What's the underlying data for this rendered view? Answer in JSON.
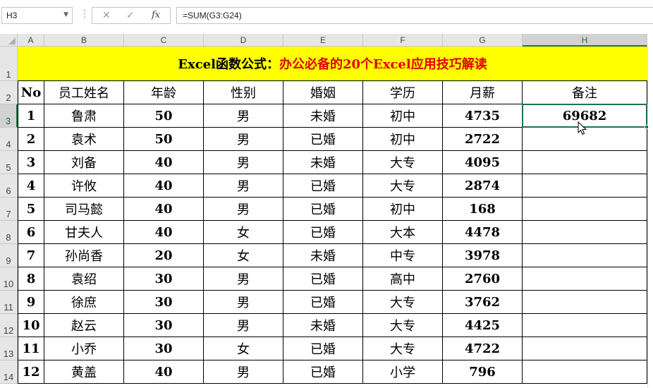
{
  "formula_bar": {
    "name_box": "H3",
    "dots": "⋮",
    "cancel_icon": "✕",
    "enter_icon": "✓",
    "fx_label": "fx",
    "formula": "=SUM(G3:G24)"
  },
  "columns": [
    "A",
    "B",
    "C",
    "D",
    "E",
    "F",
    "G",
    "H"
  ],
  "selected_column": "H",
  "rows": [
    "1",
    "2",
    "3",
    "4",
    "5",
    "6",
    "7",
    "8",
    "9",
    "10",
    "11",
    "12",
    "13",
    "14"
  ],
  "selected_row": "3",
  "title": {
    "black_part": "Excel函数公式：",
    "red_part": "办公必备的20个Excel应用技巧解读"
  },
  "colors": {
    "title_fill": "#ffff00",
    "title_red": "#e00000",
    "selection": "#217346"
  },
  "table": {
    "headers": [
      "No",
      "员工姓名",
      "年龄",
      "性别",
      "婚姻",
      "学历",
      "月薪",
      "备注"
    ],
    "rows": [
      [
        "1",
        "鲁肃",
        "50",
        "男",
        "未婚",
        "初中",
        "4735",
        "69682"
      ],
      [
        "2",
        "袁术",
        "50",
        "男",
        "已婚",
        "初中",
        "2722",
        ""
      ],
      [
        "3",
        "刘备",
        "40",
        "男",
        "未婚",
        "大专",
        "4095",
        ""
      ],
      [
        "4",
        "许攸",
        "40",
        "男",
        "已婚",
        "大专",
        "2874",
        ""
      ],
      [
        "5",
        "司马懿",
        "40",
        "男",
        "已婚",
        "初中",
        "168",
        ""
      ],
      [
        "6",
        "甘夫人",
        "40",
        "女",
        "已婚",
        "大本",
        "4478",
        ""
      ],
      [
        "7",
        "孙尚香",
        "20",
        "女",
        "未婚",
        "中专",
        "3978",
        ""
      ],
      [
        "8",
        "袁绍",
        "30",
        "男",
        "已婚",
        "高中",
        "2760",
        ""
      ],
      [
        "9",
        "徐庶",
        "30",
        "男",
        "已婚",
        "大专",
        "3762",
        ""
      ],
      [
        "10",
        "赵云",
        "30",
        "男",
        "未婚",
        "大专",
        "4425",
        ""
      ],
      [
        "11",
        "小乔",
        "30",
        "女",
        "已婚",
        "大专",
        "4722",
        ""
      ],
      [
        "12",
        "黄盖",
        "40",
        "男",
        "已婚",
        "小学",
        "796",
        ""
      ]
    ]
  }
}
